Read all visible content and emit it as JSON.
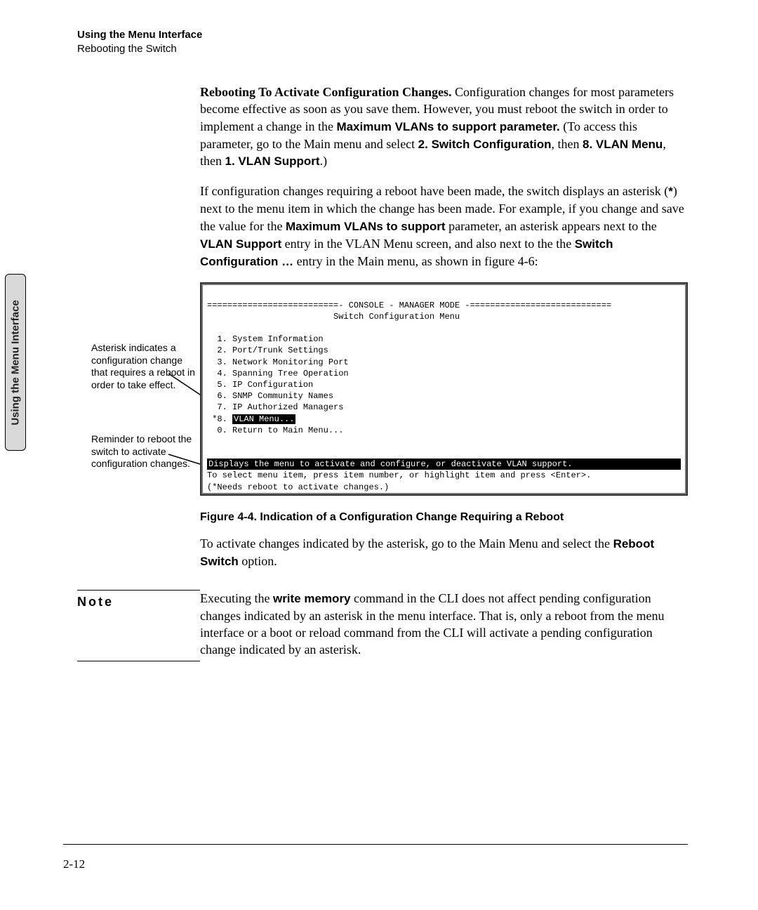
{
  "header": {
    "title": "Using the Menu Interface",
    "subtitle": "Rebooting the Switch"
  },
  "side_tab": "Using the Menu Interface",
  "para1": {
    "lead_bold": "Rebooting To Activate Configuration Changes.",
    "t1": " Configuration changes for most parameters become effective as soon as you save them. However, you must reboot the switch in order to implement a change in the ",
    "b1": "Maximum VLANs to support parameter.",
    "t2": " (To access this parameter, go to the Main menu and select  ",
    "b2": "2. Switch Configuration",
    "t3": ", then ",
    "b3": "8. VLAN Menu",
    "t4": ", then ",
    "b4": "1. VLAN Support",
    "t5": ".)"
  },
  "para2": {
    "t1": "If configuration changes requiring a reboot have been made, the switch displays an asterisk (",
    "b1": "*",
    "t2": ") next to the menu item in which the change has been made. For example, if you change and save the value for the ",
    "b2": "Maximum VLANs to support",
    "t3": " parameter, an asterisk appears next to the ",
    "b3": "VLAN Support",
    "t4": " entry in the VLAN Menu screen, and also next to the the ",
    "b4": "Switch Configuration …",
    "t5": " entry in the Main menu, as shown in figure 4-6:"
  },
  "callout1": "Asterisk indicates a configuration change that requires a reboot in order to take effect.",
  "callout2": "Reminder to reboot the switch to activate configuration changes.",
  "terminal": {
    "header": "==========================- CONSOLE - MANAGER MODE -============================",
    "subheader": "                         Switch Configuration Menu",
    "items": [
      "  1. System Information",
      "  2. Port/Trunk Settings",
      "  3. Network Monitoring Port",
      "  4. Spanning Tree Operation",
      "  5. IP Configuration",
      "  6. SNMP Community Names",
      "  7. IP Authorized Managers"
    ],
    "vlan_prefix": " *8. ",
    "vlan_label": "VLAN Menu...",
    "return": "  0. Return to Main Menu...",
    "bar": "Displays the menu to activate and configure, or deactivate VLAN support.",
    "help1": "To select menu item, press item number, or highlight item and press <Enter>.",
    "help2": "(*Needs reboot to activate changes.)"
  },
  "figure_caption": "Figure 4-4.   Indication of a Configuration Change Requiring a Reboot",
  "para3": {
    "t1": "To activate changes indicated by the asterisk, go to the Main Menu and select the ",
    "b1": "Reboot Switch",
    "t2": " option."
  },
  "note_label": "Note",
  "note_body": {
    "t1": "Executing the ",
    "b1": "write memory",
    "t2": " command in the CLI does not affect pending configuration changes indicated by an asterisk in the menu interface. That is, only a reboot from the menu interface or a boot or reload command from the CLI will activate a pending configuration change indicated by an asterisk."
  },
  "page_number": "2-12"
}
